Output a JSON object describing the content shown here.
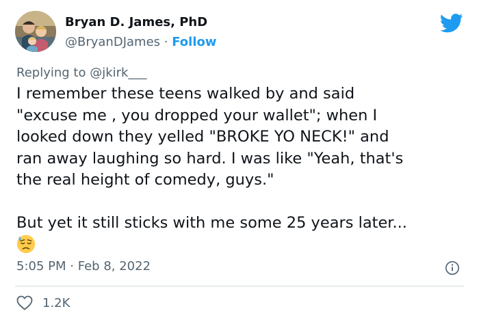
{
  "author": {
    "name": "Bryan D. James, PhD",
    "handle": "@BryanDJames",
    "separator": "·",
    "follow_label": "Follow"
  },
  "reply": {
    "prefix": "Replying to",
    "target": "@jkirk___"
  },
  "tweet": {
    "lines": [
      "I remember these teens walked by and said",
      "\"excuse me , you dropped your wallet\"; when I",
      "looked down they yelled \"BROKE YO NECK!\" and",
      "ran away laughing so hard. I was like \"Yeah, that's",
      "the real height of comedy, guys.\"",
      "But yet it still sticks with me some 25 years later..."
    ],
    "emoji": "downcast-face-with-sweat"
  },
  "meta": {
    "time": "5:05 PM",
    "separator": "·",
    "date": "Feb 8, 2022"
  },
  "stats": {
    "likes": "1.2K"
  },
  "colors": {
    "twitter_blue": "#1d9bf0",
    "text_primary": "#0f1419",
    "text_secondary": "#536471",
    "divider": "#cfd9de"
  },
  "icons": {
    "logo": "twitter-bird-icon",
    "info": "info-icon",
    "like": "heart-icon"
  }
}
